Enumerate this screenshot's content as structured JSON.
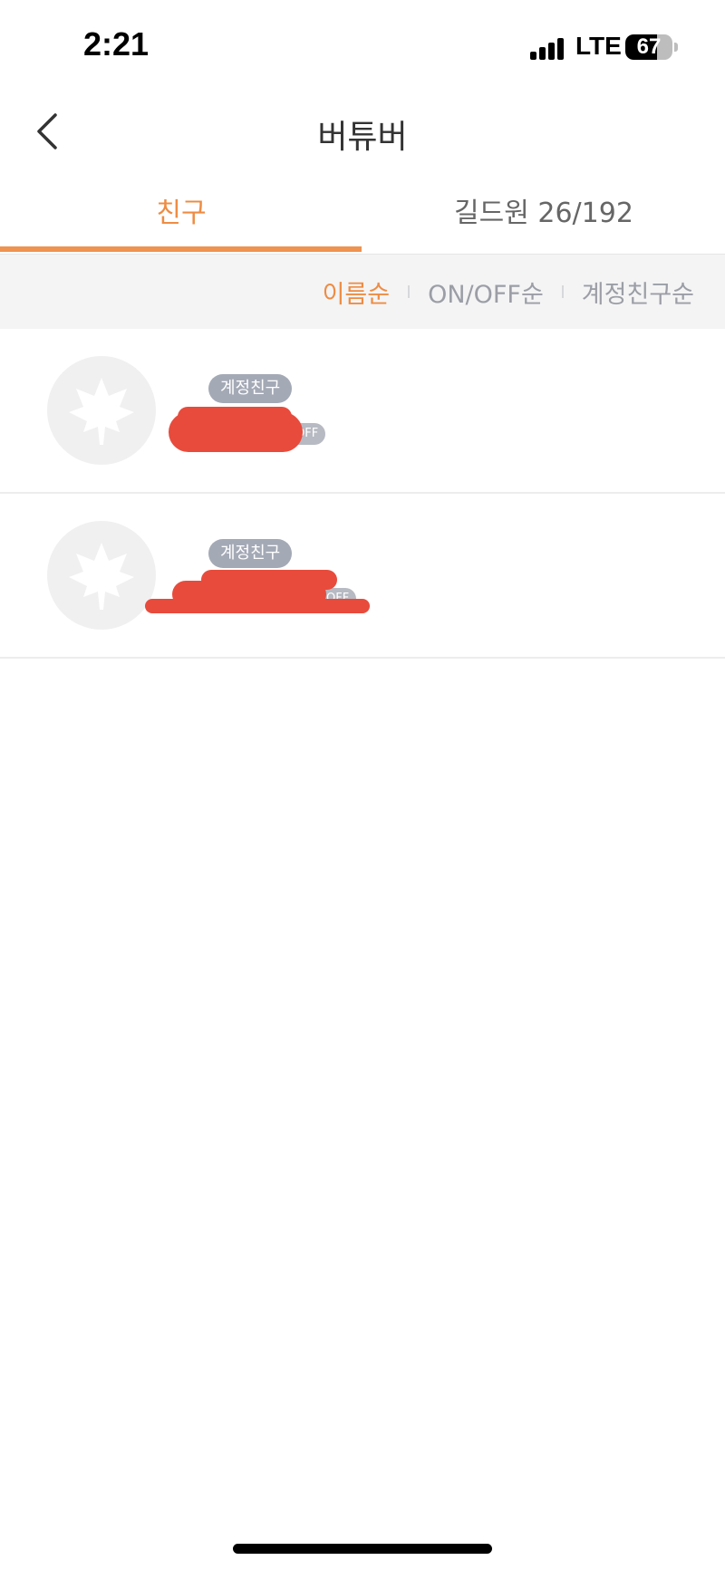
{
  "status_bar": {
    "time": "2:21",
    "network": "LTE",
    "battery": "67",
    "battery_level": 0.67
  },
  "header": {
    "title": "버튜버",
    "back_icon": "chevron-left-icon"
  },
  "tabs": [
    {
      "label": "친구",
      "active": true
    },
    {
      "label": "길드원 26/192",
      "active": false
    }
  ],
  "sort_options": [
    {
      "label": "이름순",
      "active": true
    },
    {
      "label": "ON/OFF순",
      "active": false
    },
    {
      "label": "계정친구순",
      "active": false
    }
  ],
  "friends": [
    {
      "badge": "계정친구",
      "status": "OFF",
      "avatar_icon": "maple-leaf-icon"
    },
    {
      "badge": "계정친구",
      "status": "OFF",
      "avatar_icon": "maple-leaf-icon"
    }
  ],
  "colors": {
    "accent": "#ee8c43",
    "redaction": "#e84b3c",
    "badge": "#a4a9b6"
  }
}
